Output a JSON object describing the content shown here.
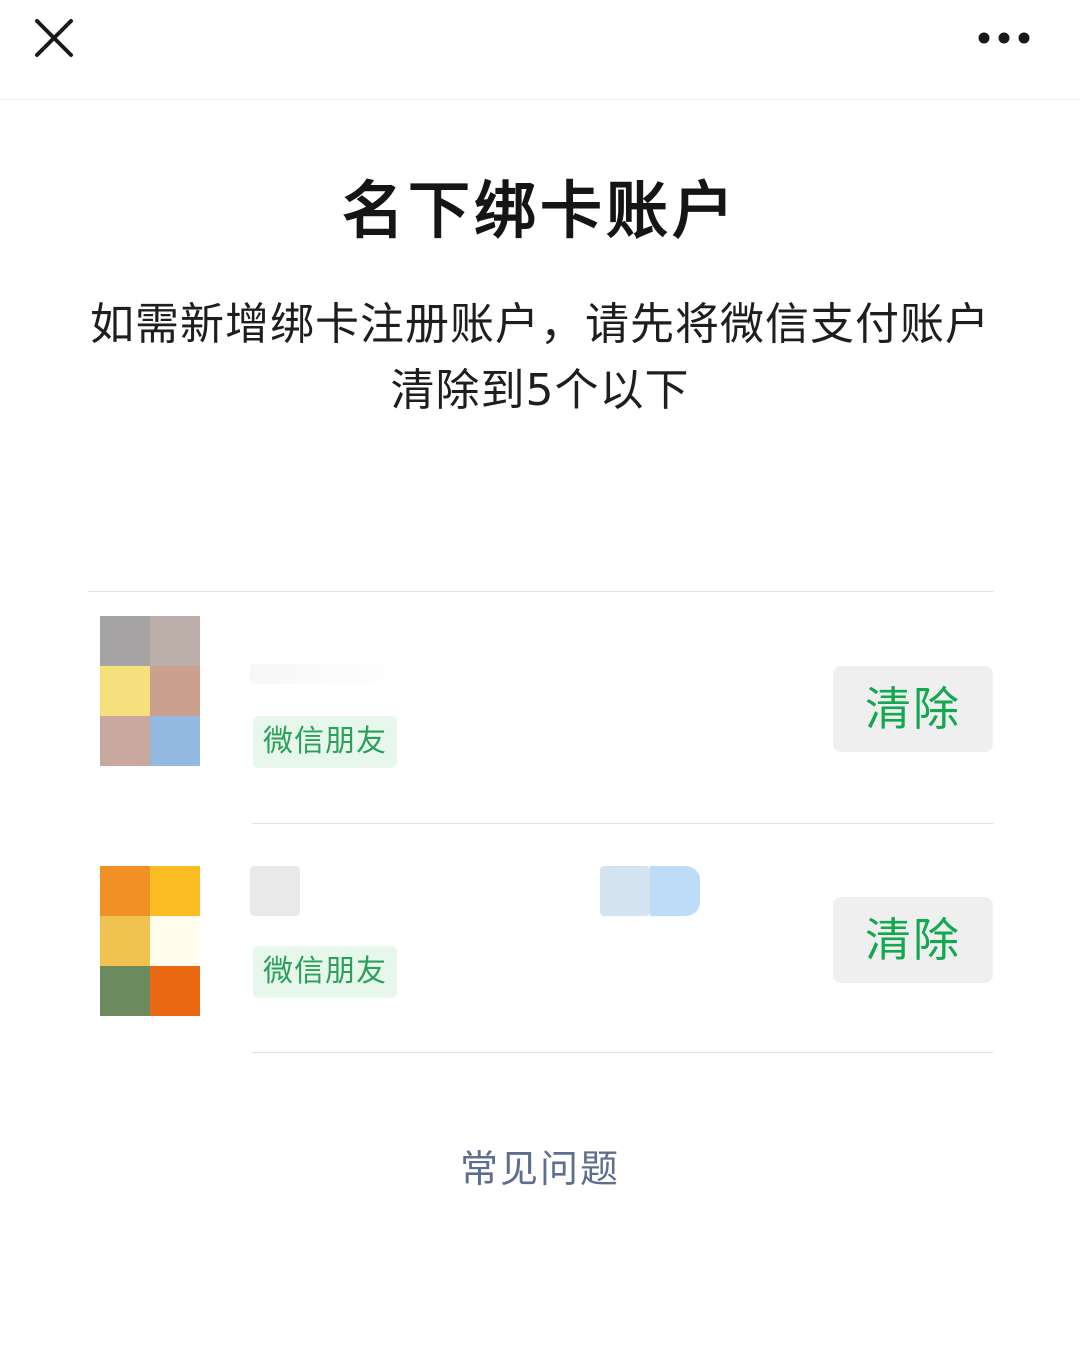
{
  "nav": {
    "close_icon": "close-icon",
    "more_icon": "more-horizontal-icon"
  },
  "page": {
    "title": "名下绑卡账户",
    "description": "如需新增绑卡注册账户，请先将微信支付账户清除到5个以下"
  },
  "accounts": [
    {
      "tag": "微信朋友",
      "action": "清除",
      "avatar_colors": [
        "#a6a3a5",
        "#bdb0ab",
        "#f6e07e",
        "#cba08e",
        "#c9a8a0",
        "#93b9e1"
      ]
    },
    {
      "tag": "微信朋友",
      "action": "清除",
      "avatar_colors": [
        "#f19025",
        "#fbbb23",
        "#f0c24f",
        "#fffcee",
        "#6b8a5d",
        "#e96811"
      ]
    }
  ],
  "footer": {
    "faq_label": "常见问题"
  },
  "colors": {
    "accent_green": "#11a84f",
    "tag_bg": "#e7f7ec",
    "tag_text": "#2ba05a",
    "link_blue": "#5d6f8f"
  }
}
